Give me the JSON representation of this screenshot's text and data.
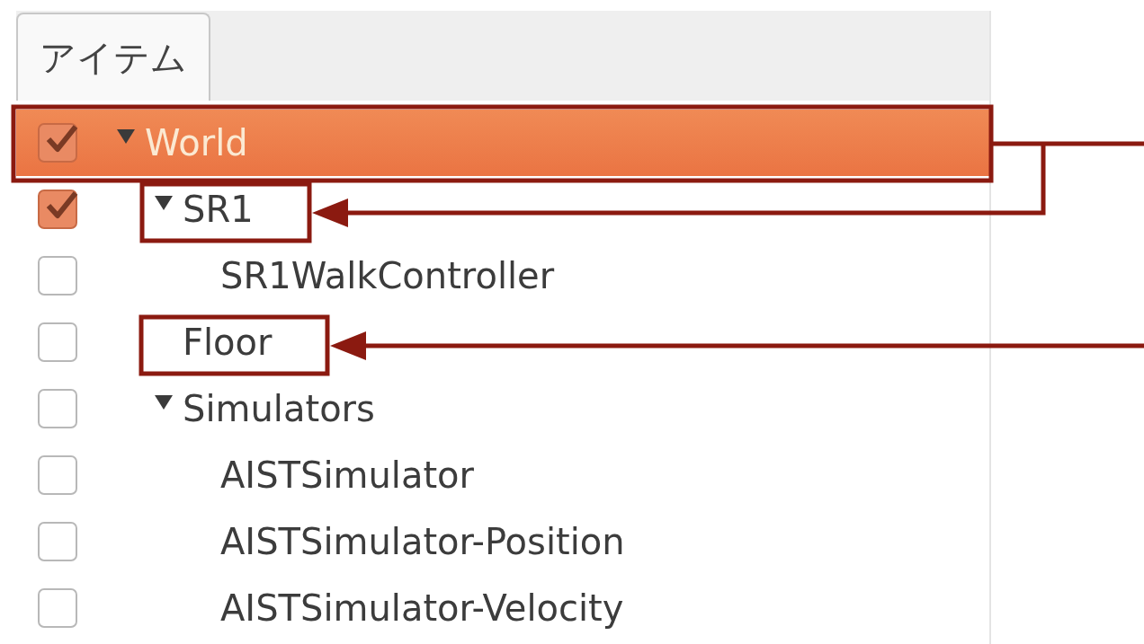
{
  "tabs": [
    {
      "label": "アイテム",
      "selected": true
    }
  ],
  "tree": [
    {
      "name": "World",
      "checked": true,
      "selected": true,
      "expanded": true,
      "children": [
        {
          "name": "SR1",
          "checked": true,
          "selected": false,
          "expanded": true,
          "children": [
            {
              "name": "SR1WalkController",
              "checked": false,
              "selected": false
            }
          ]
        },
        {
          "name": "Floor",
          "checked": false,
          "selected": false
        },
        {
          "name": "Simulators",
          "checked": false,
          "selected": false,
          "expanded": true,
          "children": [
            {
              "name": "AISTSimulator",
              "checked": false,
              "selected": false
            },
            {
              "name": "AISTSimulator-Position",
              "checked": false,
              "selected": false
            },
            {
              "name": "AISTSimulator-Velocity",
              "checked": false,
              "selected": false
            }
          ]
        }
      ]
    }
  ]
}
